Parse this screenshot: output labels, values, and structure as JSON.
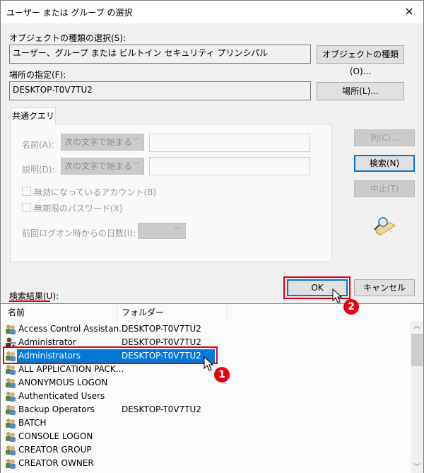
{
  "window": {
    "title": "ユーザー または グループ の選択",
    "close_icon": "close-icon"
  },
  "object_type": {
    "label": "オブジェクトの種類の選択(S):",
    "value": "ユーザー、グループ または ビルトイン セキュリティ プリンシパル",
    "button": "オブジェクトの種類(O)..."
  },
  "location": {
    "label": "場所の指定(F):",
    "value": "DESKTOP-T0V7TU2",
    "button": "場所(L)..."
  },
  "query": {
    "tab": "共通クエリ",
    "name_label": "名前(A):",
    "name_mode": "次の文字で始まる",
    "name_value": "",
    "desc_label": "説明(D):",
    "desc_mode": "次の文字で始まる",
    "desc_value": "",
    "disabled_accounts": "無効になっているアカウント(B)",
    "non_expiring_pw": "無期限のパスワード(X)",
    "days_since_logon_label": "前回ログオン時からの日数(I):",
    "days_since_logon_value": ""
  },
  "side_buttons": {
    "columns": "列(C)...",
    "search": "検索(N)",
    "stop": "中止(T)",
    "search_graphic": "magnifier-folder-icon"
  },
  "actions": {
    "ok": "OK",
    "cancel": "キャンセル"
  },
  "results": {
    "label": "検索結果(U):",
    "columns": [
      "名前",
      "フォルダー"
    ],
    "rows": [
      {
        "name": "Access Control Assistan...",
        "folder": "DESKTOP-T0V7TU2",
        "icon": "group-icon"
      },
      {
        "name": "Administrator",
        "folder": "DESKTOP-T0V7TU2",
        "icon": "user-icon"
      },
      {
        "name": "Administrators",
        "folder": "DESKTOP-T0V7TU2",
        "icon": "group-icon",
        "selected": true
      },
      {
        "name": "ALL APPLICATION PACK...",
        "folder": "",
        "icon": "group-icon"
      },
      {
        "name": "ANONYMOUS LOGON",
        "folder": "",
        "icon": "group-icon"
      },
      {
        "name": "Authenticated Users",
        "folder": "",
        "icon": "group-icon"
      },
      {
        "name": "Backup Operators",
        "folder": "DESKTOP-T0V7TU2",
        "icon": "group-icon"
      },
      {
        "name": "BATCH",
        "folder": "",
        "icon": "group-icon"
      },
      {
        "name": "CONSOLE LOGON",
        "folder": "",
        "icon": "group-icon"
      },
      {
        "name": "CREATOR GROUP",
        "folder": "",
        "icon": "group-icon"
      },
      {
        "name": "CREATOR OWNER",
        "folder": "",
        "icon": "group-icon"
      }
    ]
  },
  "annotations": {
    "step1": "1",
    "step2": "2",
    "highlight_color": "#e60012",
    "selection_color": "#0078d7"
  }
}
